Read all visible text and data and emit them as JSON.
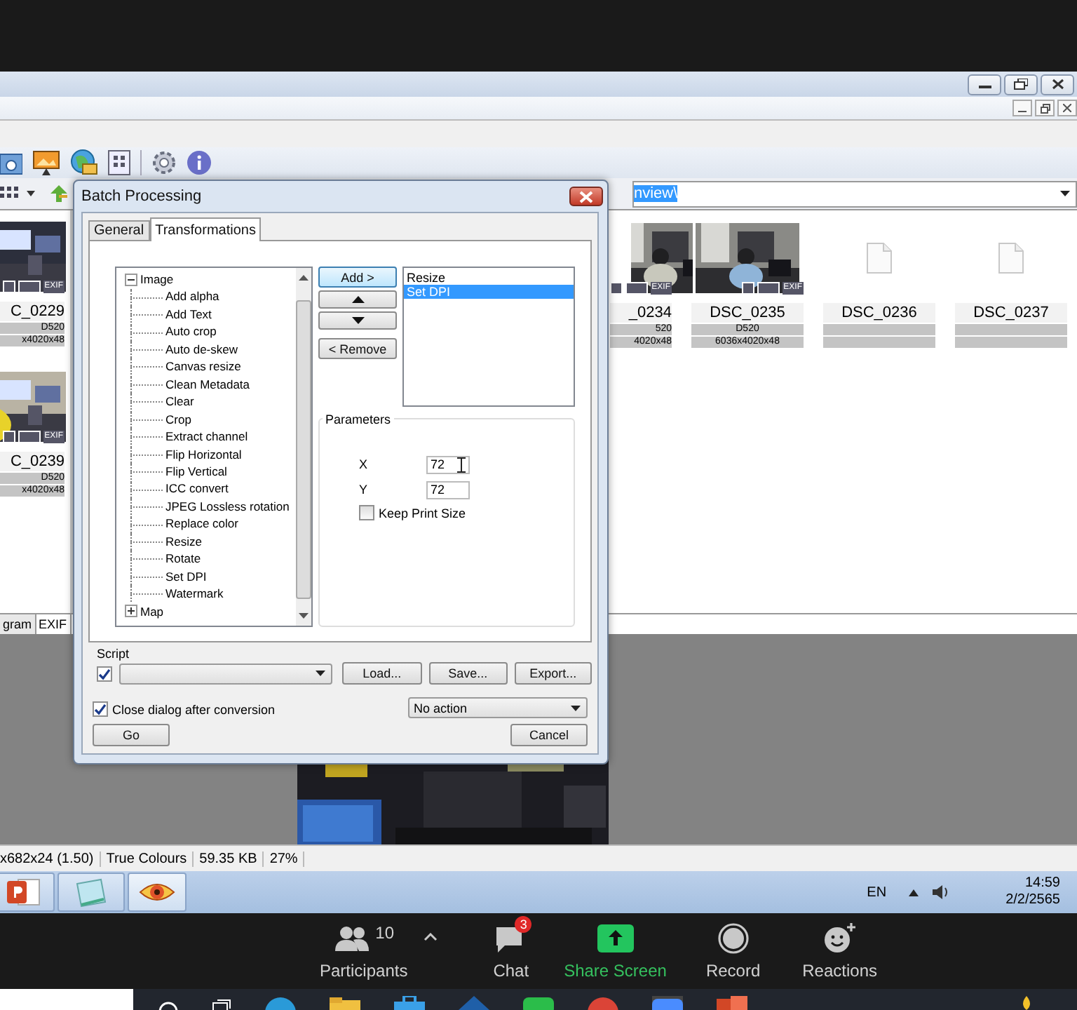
{
  "xnview": {
    "address": {
      "value": "nview\\",
      "selected": true
    },
    "left_thumbnails": [
      {
        "name": "C_0229",
        "camera": "D520",
        "size": "x4020x48",
        "badge": "EXIF"
      },
      {
        "name": "C_0239",
        "camera": "D520",
        "size": "x4020x48",
        "badge": "EXIF"
      }
    ],
    "thumbnails": [
      {
        "name": "_0234",
        "camera": "520",
        "size": "4020x48",
        "badge": "EXIF"
      },
      {
        "name": "DSC_0235",
        "camera": "D520",
        "size": "6036x4020x48",
        "badge": "EXIF"
      },
      {
        "name": "DSC_0236",
        "kind": "file"
      },
      {
        "name": "DSC_0237",
        "kind": "file"
      }
    ],
    "pane_tabs": [
      {
        "label": "gram",
        "selected": false
      },
      {
        "label": "EXIF",
        "selected": true
      }
    ],
    "status_bar": [
      "x682x24 (1.50)",
      "True Colours",
      "59.35 KB",
      "27%"
    ]
  },
  "dialog": {
    "title": "Batch Processing",
    "tabs": [
      {
        "label": "General",
        "selected": false
      },
      {
        "label": "Transformations",
        "selected": true
      }
    ],
    "tree": [
      {
        "label": "Image",
        "expanded": true,
        "children": [
          {
            "label": "Add alpha"
          },
          {
            "label": "Add Text"
          },
          {
            "label": "Auto crop"
          },
          {
            "label": "Auto de-skew"
          },
          {
            "label": "Canvas resize"
          },
          {
            "label": "Clean Metadata"
          },
          {
            "label": "Clear"
          },
          {
            "label": "Crop"
          },
          {
            "label": "Extract channel"
          },
          {
            "label": "Flip Horizontal"
          },
          {
            "label": "Flip Vertical"
          },
          {
            "label": "ICC convert"
          },
          {
            "label": "JPEG Lossless rotation"
          },
          {
            "label": "Replace color"
          },
          {
            "label": "Resize"
          },
          {
            "label": "Rotate"
          },
          {
            "label": "Set DPI"
          },
          {
            "label": "Watermark"
          }
        ]
      },
      {
        "label": "Map",
        "expanded": false
      }
    ],
    "add_button": "Add >",
    "remove_button": "< Remove",
    "selected_list": [
      {
        "label": "Resize",
        "selected": false
      },
      {
        "label": "Set DPI",
        "selected": true
      }
    ],
    "parameters": {
      "title": "Parameters",
      "fields": [
        {
          "label": "X",
          "value": "72"
        },
        {
          "label": "Y",
          "value": "72"
        }
      ],
      "keep_print_size": {
        "label": "Keep Print Size",
        "checked": false
      }
    },
    "script": {
      "label": "Script",
      "checked": true,
      "buttons": [
        "Load...",
        "Save...",
        "Export..."
      ]
    },
    "close_after": {
      "label": "Close dialog after conversion",
      "checked": true
    },
    "after_action": "No action",
    "go_button": "Go",
    "cancel_button": "Cancel"
  },
  "taskbar": {
    "language": "EN",
    "time": "14:59",
    "date": "2/2/2565"
  },
  "zoom_toolbar": [
    {
      "kind": "participants",
      "label": "Participants",
      "count": "10"
    },
    {
      "kind": "chat",
      "label": "Chat",
      "badge": "3"
    },
    {
      "kind": "share",
      "label": "Share Screen"
    },
    {
      "kind": "record",
      "label": "Record"
    },
    {
      "kind": "reactions",
      "label": "Reactions"
    }
  ]
}
